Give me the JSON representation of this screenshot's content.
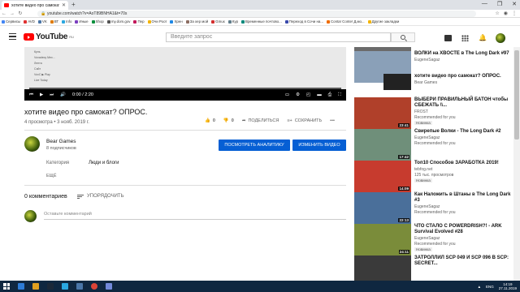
{
  "browser": {
    "tab_title": "хотите видео про самокат? О",
    "new_tab": "+",
    "url": "youtube.com/watch?v=AoT89BNHA1&t=70s",
    "window_controls": [
      "—",
      "❐",
      "✕"
    ],
    "bookmarks": [
      "Сервисы",
      "AVD",
      "VK",
      "ВТ",
      "Info",
      "Иные",
      "Shop",
      "my.dom.gov",
      "Пер",
      "Очи Роот",
      "Хрен",
      "За хер мой",
      "Gmux",
      "Кур",
      "Временные почтово...",
      "Переход в Сочи на...",
      "Conta! Conte! Д.мо...",
      "Другие закладки"
    ]
  },
  "header": {
    "logo_word": "YouTube",
    "logo_sup": "RU",
    "search_placeholder": "Введите запрос"
  },
  "player": {
    "time": "0:00 / 2:20",
    "screen_rows": [
      "Куль",
      "Voxadecy Mex...",
      "Лента",
      "Сайт",
      "VoxC ▶ Play",
      "Live Today"
    ]
  },
  "video": {
    "title": "хотите видео про самокат? ОПРОС.",
    "meta": "4 просмотра • 3 нояб. 2019 г.",
    "likes": "0",
    "dislikes": "0",
    "share_label": "ПОДЕЛИТЬСЯ",
    "save_label": "СОХРАНИТЬ",
    "more_label": "•••"
  },
  "channel": {
    "name": "Bear Games",
    "subs": "8 подписчиков",
    "analytics_button": "ПОСМОТРЕТЬ АНАЛИТИКУ",
    "edit_button": "ИЗМЕНИТЬ ВИДЕО",
    "category_label": "Категория",
    "category_value": "Люди и блоги",
    "more_label": "ЕЩЁ"
  },
  "comments": {
    "count": "0 комментариев",
    "sort_label": "УПОРЯДОЧИТЬ",
    "input_placeholder": "Оставьте комментарий"
  },
  "sidebar": {
    "items": [
      {
        "title": "",
        "channel": "",
        "duration": "24:57",
        "badge": "",
        "thumb": "#6b6b6b"
      },
      {
        "title": "ВОЛКИ на ХВОСТЕ в The Long Dark #97",
        "channel": "EugeneSagaz",
        "duration": "25:50",
        "badge": "",
        "thumb": "#8aa0b8"
      },
      {
        "title": "хотите видео про самокат? ОПРОС.",
        "channel": "Bear Games",
        "duration": "",
        "badge": "",
        "thumb": "#222222"
      },
      {
        "title": "ВЫБЕРИ ПРАВИЛЬНЫЙ БАТОН чтобы СБЕЖАТЬ \\\\...",
        "channel": "FROST",
        "duration": "23:41",
        "badge": "Новинка",
        "extra": "Recommended for you",
        "thumb": "#b0402a"
      },
      {
        "title": "Свирепые Волки - The Long Dark #2",
        "channel": "EugeneSagaz",
        "duration": "17:42",
        "badge": "",
        "extra": "Recommended for you",
        "thumb": "#6f8f7a"
      },
      {
        "title": "Топ10 Способов ЗАРАБОТКА 2019!",
        "channel": "tebfog.net",
        "duration": "14:09",
        "badge": "Новинка",
        "extra": "125 тыс. просмотров",
        "thumb": "#c73b2e"
      },
      {
        "title": "Как Наложить в Штаны в The Long Dark #3",
        "channel": "EugeneSagaz",
        "duration": "22:13",
        "badge": "",
        "extra": "Recommended for you",
        "thumb": "#4a6f9a"
      },
      {
        "title": "ЧТО СТАЛО С POWERDRISH?! - ARK Survival Evolved #28",
        "channel": "EugeneSagaz",
        "duration": "24:11",
        "badge": "Новинка",
        "extra": "Recommended for you",
        "thumb": "#7a8c3a"
      },
      {
        "title": "ЗАТРОЛЛИЛ SCP 049 И SCP 096 В SCP: SECRET...",
        "channel": "",
        "duration": "",
        "badge": "",
        "thumb": "#3a3a3a"
      }
    ]
  },
  "taskbar": {
    "lang": "ENG",
    "time": "14:19",
    "date": "27.11.2019"
  }
}
